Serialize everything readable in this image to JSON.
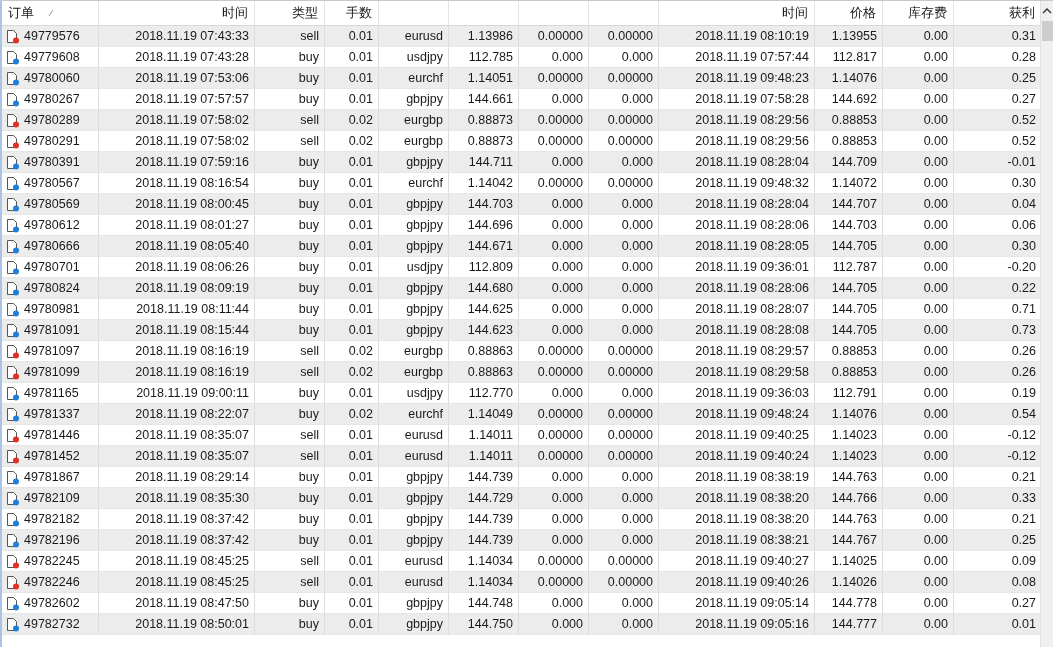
{
  "table": {
    "columns_left": [
      {
        "label": "订单",
        "sorted": true
      },
      {
        "label": "时间",
        "sorted": false
      },
      {
        "label": "类型",
        "sorted": false
      },
      {
        "label": "手数",
        "sorted": false
      }
    ],
    "columns_right": [
      {
        "label": "时间",
        "sorted": false
      },
      {
        "label": "价格",
        "sorted": false
      },
      {
        "label": "库存费",
        "sorted": false
      },
      {
        "label": "获利",
        "sorted": false
      }
    ],
    "rows": [
      {
        "kind": "sell",
        "cells": [
          "49779576",
          "2018.11.19 07:43:33",
          "sell",
          "0.01",
          "eurusd",
          "1.13986",
          "0.00000",
          "0.00000",
          "2018.11.19 08:10:19",
          "1.13955",
          "0.00",
          "0.31"
        ]
      },
      {
        "kind": "buy",
        "cells": [
          "49779608",
          "2018.11.19 07:43:28",
          "buy",
          "0.01",
          "usdjpy",
          "112.785",
          "0.000",
          "0.000",
          "2018.11.19 07:57:44",
          "112.817",
          "0.00",
          "0.28"
        ]
      },
      {
        "kind": "buy",
        "cells": [
          "49780060",
          "2018.11.19 07:53:06",
          "buy",
          "0.01",
          "eurchf",
          "1.14051",
          "0.00000",
          "0.00000",
          "2018.11.19 09:48:23",
          "1.14076",
          "0.00",
          "0.25"
        ]
      },
      {
        "kind": "buy",
        "cells": [
          "49780267",
          "2018.11.19 07:57:57",
          "buy",
          "0.01",
          "gbpjpy",
          "144.661",
          "0.000",
          "0.000",
          "2018.11.19 07:58:28",
          "144.692",
          "0.00",
          "0.27"
        ]
      },
      {
        "kind": "sell",
        "cells": [
          "49780289",
          "2018.11.19 07:58:02",
          "sell",
          "0.02",
          "eurgbp",
          "0.88873",
          "0.00000",
          "0.00000",
          "2018.11.19 08:29:56",
          "0.88853",
          "0.00",
          "0.52"
        ]
      },
      {
        "kind": "sell",
        "cells": [
          "49780291",
          "2018.11.19 07:58:02",
          "sell",
          "0.02",
          "eurgbp",
          "0.88873",
          "0.00000",
          "0.00000",
          "2018.11.19 08:29:56",
          "0.88853",
          "0.00",
          "0.52"
        ]
      },
      {
        "kind": "buy",
        "cells": [
          "49780391",
          "2018.11.19 07:59:16",
          "buy",
          "0.01",
          "gbpjpy",
          "144.711",
          "0.000",
          "0.000",
          "2018.11.19 08:28:04",
          "144.709",
          "0.00",
          "-0.01"
        ]
      },
      {
        "kind": "buy",
        "cells": [
          "49780567",
          "2018.11.19 08:16:54",
          "buy",
          "0.01",
          "eurchf",
          "1.14042",
          "0.00000",
          "0.00000",
          "2018.11.19 09:48:32",
          "1.14072",
          "0.00",
          "0.30"
        ]
      },
      {
        "kind": "buy",
        "cells": [
          "49780569",
          "2018.11.19 08:00:45",
          "buy",
          "0.01",
          "gbpjpy",
          "144.703",
          "0.000",
          "0.000",
          "2018.11.19 08:28:04",
          "144.707",
          "0.00",
          "0.04"
        ]
      },
      {
        "kind": "buy",
        "cells": [
          "49780612",
          "2018.11.19 08:01:27",
          "buy",
          "0.01",
          "gbpjpy",
          "144.696",
          "0.000",
          "0.000",
          "2018.11.19 08:28:06",
          "144.703",
          "0.00",
          "0.06"
        ]
      },
      {
        "kind": "buy",
        "cells": [
          "49780666",
          "2018.11.19 08:05:40",
          "buy",
          "0.01",
          "gbpjpy",
          "144.671",
          "0.000",
          "0.000",
          "2018.11.19 08:28:05",
          "144.705",
          "0.00",
          "0.30"
        ]
      },
      {
        "kind": "buy",
        "cells": [
          "49780701",
          "2018.11.19 08:06:26",
          "buy",
          "0.01",
          "usdjpy",
          "112.809",
          "0.000",
          "0.000",
          "2018.11.19 09:36:01",
          "112.787",
          "0.00",
          "-0.20"
        ]
      },
      {
        "kind": "buy",
        "cells": [
          "49780824",
          "2018.11.19 08:09:19",
          "buy",
          "0.01",
          "gbpjpy",
          "144.680",
          "0.000",
          "0.000",
          "2018.11.19 08:28:06",
          "144.705",
          "0.00",
          "0.22"
        ]
      },
      {
        "kind": "buy",
        "cells": [
          "49780981",
          "2018.11.19 08:11:44",
          "buy",
          "0.01",
          "gbpjpy",
          "144.625",
          "0.000",
          "0.000",
          "2018.11.19 08:28:07",
          "144.705",
          "0.00",
          "0.71"
        ]
      },
      {
        "kind": "buy",
        "cells": [
          "49781091",
          "2018.11.19 08:15:44",
          "buy",
          "0.01",
          "gbpjpy",
          "144.623",
          "0.000",
          "0.000",
          "2018.11.19 08:28:08",
          "144.705",
          "0.00",
          "0.73"
        ]
      },
      {
        "kind": "sell",
        "cells": [
          "49781097",
          "2018.11.19 08:16:19",
          "sell",
          "0.02",
          "eurgbp",
          "0.88863",
          "0.00000",
          "0.00000",
          "2018.11.19 08:29:57",
          "0.88853",
          "0.00",
          "0.26"
        ]
      },
      {
        "kind": "sell",
        "cells": [
          "49781099",
          "2018.11.19 08:16:19",
          "sell",
          "0.02",
          "eurgbp",
          "0.88863",
          "0.00000",
          "0.00000",
          "2018.11.19 08:29:58",
          "0.88853",
          "0.00",
          "0.26"
        ]
      },
      {
        "kind": "buy",
        "cells": [
          "49781165",
          "2018.11.19 09:00:11",
          "buy",
          "0.01",
          "usdjpy",
          "112.770",
          "0.000",
          "0.000",
          "2018.11.19 09:36:03",
          "112.791",
          "0.00",
          "0.19"
        ]
      },
      {
        "kind": "buy",
        "cells": [
          "49781337",
          "2018.11.19 08:22:07",
          "buy",
          "0.02",
          "eurchf",
          "1.14049",
          "0.00000",
          "0.00000",
          "2018.11.19 09:48:24",
          "1.14076",
          "0.00",
          "0.54"
        ]
      },
      {
        "kind": "sell",
        "cells": [
          "49781446",
          "2018.11.19 08:35:07",
          "sell",
          "0.01",
          "eurusd",
          "1.14011",
          "0.00000",
          "0.00000",
          "2018.11.19 09:40:25",
          "1.14023",
          "0.00",
          "-0.12"
        ]
      },
      {
        "kind": "sell",
        "cells": [
          "49781452",
          "2018.11.19 08:35:07",
          "sell",
          "0.01",
          "eurusd",
          "1.14011",
          "0.00000",
          "0.00000",
          "2018.11.19 09:40:24",
          "1.14023",
          "0.00",
          "-0.12"
        ]
      },
      {
        "kind": "buy",
        "cells": [
          "49781867",
          "2018.11.19 08:29:14",
          "buy",
          "0.01",
          "gbpjpy",
          "144.739",
          "0.000",
          "0.000",
          "2018.11.19 08:38:19",
          "144.763",
          "0.00",
          "0.21"
        ]
      },
      {
        "kind": "buy",
        "cells": [
          "49782109",
          "2018.11.19 08:35:30",
          "buy",
          "0.01",
          "gbpjpy",
          "144.729",
          "0.000",
          "0.000",
          "2018.11.19 08:38:20",
          "144.766",
          "0.00",
          "0.33"
        ]
      },
      {
        "kind": "buy",
        "cells": [
          "49782182",
          "2018.11.19 08:37:42",
          "buy",
          "0.01",
          "gbpjpy",
          "144.739",
          "0.000",
          "0.000",
          "2018.11.19 08:38:20",
          "144.763",
          "0.00",
          "0.21"
        ]
      },
      {
        "kind": "buy",
        "cells": [
          "49782196",
          "2018.11.19 08:37:42",
          "buy",
          "0.01",
          "gbpjpy",
          "144.739",
          "0.000",
          "0.000",
          "2018.11.19 08:38:21",
          "144.767",
          "0.00",
          "0.25"
        ]
      },
      {
        "kind": "sell",
        "cells": [
          "49782245",
          "2018.11.19 08:45:25",
          "sell",
          "0.01",
          "eurusd",
          "1.14034",
          "0.00000",
          "0.00000",
          "2018.11.19 09:40:27",
          "1.14025",
          "0.00",
          "0.09"
        ]
      },
      {
        "kind": "sell",
        "cells": [
          "49782246",
          "2018.11.19 08:45:25",
          "sell",
          "0.01",
          "eurusd",
          "1.14034",
          "0.00000",
          "0.00000",
          "2018.11.19 09:40:26",
          "1.14026",
          "0.00",
          "0.08"
        ]
      },
      {
        "kind": "buy",
        "cells": [
          "49782602",
          "2018.11.19 08:47:50",
          "buy",
          "0.01",
          "gbpjpy",
          "144.748",
          "0.000",
          "0.000",
          "2018.11.19 09:05:14",
          "144.778",
          "0.00",
          "0.27"
        ]
      },
      {
        "kind": "buy",
        "cells": [
          "49782732",
          "2018.11.19 08:50:01",
          "buy",
          "0.01",
          "gbpjpy",
          "144.750",
          "0.000",
          "0.000",
          "2018.11.19 09:05:16",
          "144.777",
          "0.00",
          "0.01"
        ]
      }
    ]
  }
}
